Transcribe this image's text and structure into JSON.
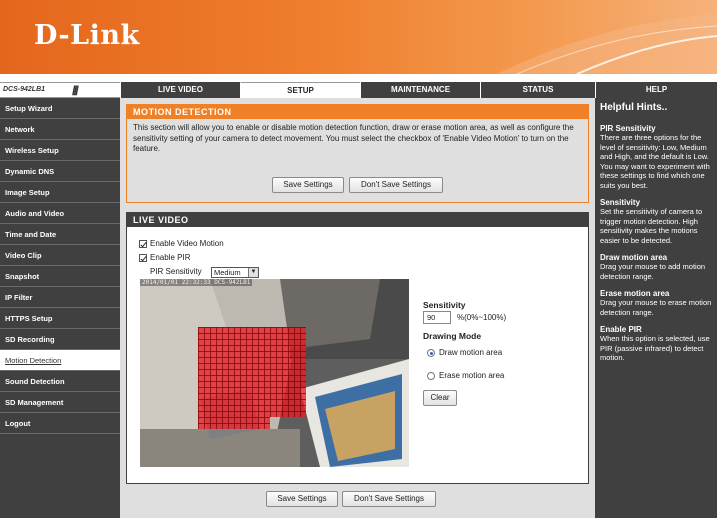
{
  "header": {
    "logo_text": "D-Link",
    "brand_color": "#e4661c"
  },
  "nav": {
    "model": "DCS-942LB1",
    "slashes": "///",
    "tabs": [
      "LIVE VIDEO",
      "SETUP",
      "MAINTENANCE",
      "STATUS",
      "HELP"
    ],
    "active_tab": "SETUP"
  },
  "sidebar": {
    "items": [
      "Setup Wizard",
      "Network",
      "Wireless Setup",
      "Dynamic DNS",
      "Image Setup",
      "Audio and Video",
      "Time and Date",
      "Video Clip",
      "Snapshot",
      "IP Filter",
      "HTTPS Setup",
      "SD Recording",
      "Motion Detection",
      "Sound Detection",
      "SD Management",
      "Logout"
    ],
    "active_item": "Motion Detection"
  },
  "motion": {
    "title": "MOTION DETECTION",
    "description": "This section will allow you to enable or disable motion detection function, draw or erase motion area, as well as configure the sensitivity setting of your camera to detect movement. You must select the checkbox of 'Enable Video Motion' to turn on the feature.",
    "save_label": "Save Settings",
    "dont_save_label": "Don't Save Settings"
  },
  "live": {
    "title": "LIVE VIDEO",
    "enable_video_motion_label": "Enable Video Motion",
    "enable_video_motion_checked": true,
    "enable_pir_label": "Enable PIR",
    "enable_pir_checked": true,
    "pir_sensitivity_label": "PIR Sensitivity",
    "pir_sensitivity_value": "Medium",
    "camera_timestamp": "2014/01/01 22:32:33 DCS-942LB1",
    "sensitivity_label": "Sensitivity",
    "sensitivity_value": "90",
    "sensitivity_range": "%(0%~100%)",
    "drawing_mode_label": "Drawing Mode",
    "draw_label": "Draw motion area",
    "erase_label": "Erase motion area",
    "drawing_mode_selected": "Draw motion area",
    "clear_label": "Clear"
  },
  "bottom": {
    "save_label": "Save Settings",
    "dont_save_label": "Don't Save Settings"
  },
  "help": {
    "title": "Helpful Hints..",
    "sections": [
      {
        "head": "PIR Sensitivity",
        "text": "There are three options for the level of sensitivity: Low, Medium and High, and the default is Low. You may want to experiment with these settings to find which one suits you best."
      },
      {
        "head": "Sensitivity",
        "text": "Set the sensitivity of camera to trigger motion detection. High sensitivity makes the motions easier to be detected."
      },
      {
        "head": "Draw motion area",
        "text": "Drag your mouse to add motion detection range."
      },
      {
        "head": "Erase motion area",
        "text": "Drag your mouse to erase motion detection range."
      },
      {
        "head": "Enable PIR",
        "text": "When this option is selected, use PIR (passive infrared) to detect motion."
      }
    ]
  }
}
